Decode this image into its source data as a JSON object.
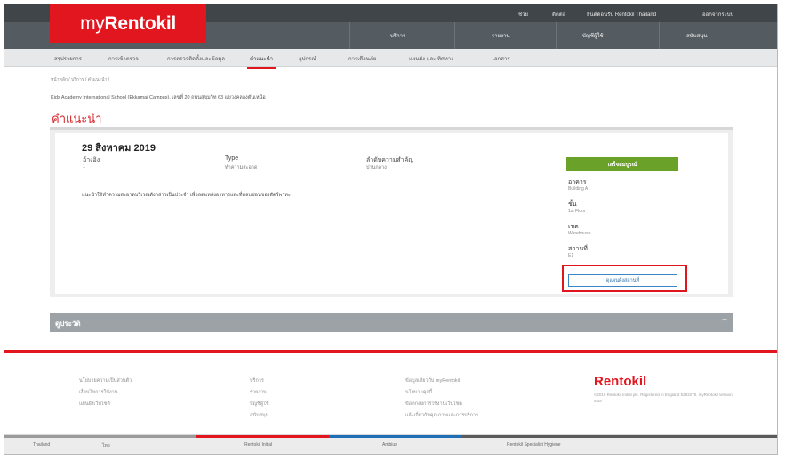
{
  "header": {
    "utility_links": [
      "ช่วย",
      "ติดต่อ",
      "ยินดีต้อนรับ Rentokil Thailand",
      "ออกจากระบบ"
    ],
    "logo_prefix": "my",
    "logo_brand": "Rentokil",
    "main_nav": [
      "บริการ",
      "รายงาน",
      "บัญชีผู้ใช้",
      "สนับสนุน"
    ],
    "main_nav_active": "บริการ"
  },
  "subnav": {
    "items": [
      "สรุปรายการ",
      "การเข้าตรวจ",
      "การตรวจติดตั้งและข้อมูล",
      "คำแนะนำ",
      "อุปกรณ์",
      "การเตือนภัย",
      "แผนผัง และ ทิศทาง",
      "เอกสาร"
    ],
    "active": "คำแนะนำ"
  },
  "breadcrumb": "หน้าหลัก  /  บริการ  /  คำแนะนำ  /",
  "site_line": "Kids Academy International School (Ekkamai Campus), เลขที่ 20 ถนนสุขุมวิท 63 แขวงคลองตันเหนือ",
  "page_title": "คำแนะนำ",
  "recommendation": {
    "date": "29 สิงหาคม 2019",
    "fields": [
      {
        "label": "อ้างอิง",
        "value": "1"
      },
      {
        "label": "Type",
        "value": "ทำความสะอาด"
      },
      {
        "label": "ลำดับความสำคัญ",
        "value": "ปานกลาง"
      }
    ],
    "description": "แนะนำให้ทำความสะอาดบริเวณดังกล่าวเป็นประจำ เพื่อลดแหล่งอาหารและที่หลบซ่อนของสัตว์พาหะ",
    "status": "เสร็จสมบูรณ์",
    "location": [
      {
        "label": "อาคาร",
        "value": "Building A"
      },
      {
        "label": "ชั้น",
        "value": "1st Floor"
      },
      {
        "label": "เขต",
        "value": "Warehouse"
      },
      {
        "label": "สถานที่",
        "value": "E1"
      }
    ],
    "location_button": "ดูแผนผังสถานที่"
  },
  "history": {
    "title": "ดูประวัติ",
    "toggle": "−"
  },
  "footer": {
    "col1": [
      "นโยบายความเป็นส่วนตัว",
      "เงื่อนไขการใช้งาน",
      "แผนผังเว็บไซต์"
    ],
    "col2": [
      "บริการ",
      "รายงาน",
      "บัญชีผู้ใช้",
      "สนับสนุน"
    ],
    "col3": [
      "ข้อมูลเกี่ยวกับ myRentokil",
      "นโยบายคุกกี้",
      "ข้อตกลงการใช้งานเว็บไซต์",
      "แจ้งเกี่ยวกับคุณภาพและการบริการ"
    ],
    "brand": "Rentokil",
    "legal": "©2019 Rentokil Initial plc. Registered in England 5393279. myRentokil version 3.10"
  },
  "bottom_bar": {
    "items": [
      "Thailand",
      "ไทย",
      "Rentokil Initial",
      "Ambius",
      "Rentokil Specialist Hygiene"
    ],
    "colors": [
      "#9b9b9b",
      "#e2161f",
      "#1e6fb5",
      "#5a5a5a"
    ]
  }
}
